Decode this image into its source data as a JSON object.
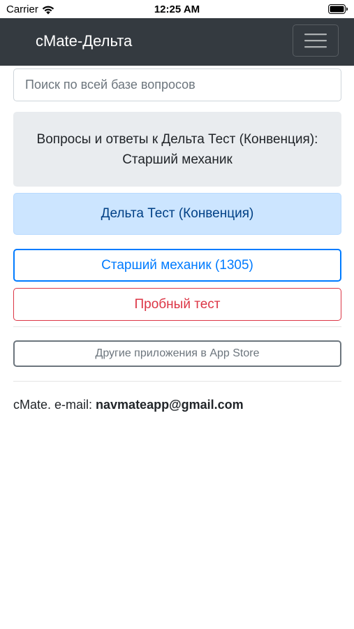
{
  "status_bar": {
    "carrier": "Carrier",
    "time": "12:25 AM"
  },
  "navbar": {
    "brand": "cMate-Дельта",
    "toggler_icon": "hamburger-menu-icon"
  },
  "search": {
    "placeholder": "Поиск по всей базе вопросов",
    "value": ""
  },
  "header_box": {
    "line1": "Вопросы и ответы к Дельта Тест (Конвенция):",
    "line2": "Старший механик"
  },
  "category_label": "Дельта Тест (Конвенция)",
  "buttons": {
    "chief_engineer": "Старший механик (1305)",
    "trial_test": "Пробный тест",
    "other_apps": "Другие приложения в App Store"
  },
  "footer": {
    "prefix": "cMate. e-mail: ",
    "email": "navmateapp@gmail.com"
  },
  "colors": {
    "navbar_bg": "#343a40",
    "primary": "#007bff",
    "danger": "#dc3545",
    "secondary": "#6c757d",
    "info_bg": "#cce5ff",
    "jumbotron_bg": "#e9ecef"
  }
}
